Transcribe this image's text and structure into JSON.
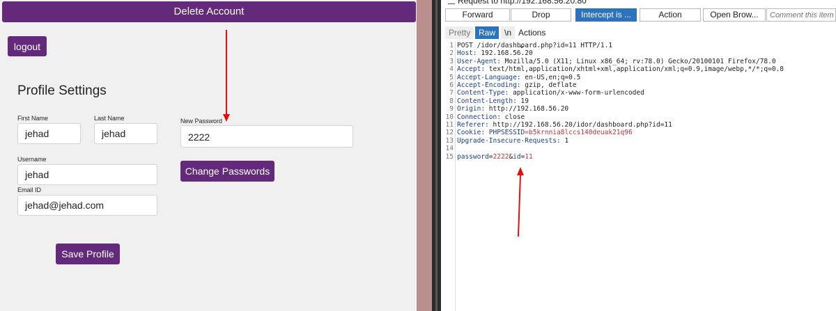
{
  "app": {
    "delete_account": "Delete Account",
    "logout": "logout",
    "profile_title": "Profile Settings",
    "first_name_label": "First Name",
    "first_name_value": "jehad",
    "last_name_label": "Last Name",
    "last_name_value": "jehad",
    "new_password_label": "New Password",
    "new_password_value": "2222",
    "change_password_button": "Change Passwords",
    "username_label": "Username",
    "username_value": "jehad",
    "email_label": "Email ID",
    "email_value": "jehad@jehad.com",
    "save_profile_button": "Save Profile",
    "accent_color": "#632a7c"
  },
  "burp": {
    "title": "Request to http://192.168.56.20:80",
    "toolbar": {
      "forward": "Forward",
      "drop": "Drop",
      "intercept": "Intercept is ...",
      "action": "Action",
      "open_browser": "Open Brow...",
      "comment_placeholder": "Comment this item"
    },
    "view_tabs": {
      "pretty": "Pretty",
      "raw": "Raw",
      "newline": "\\n",
      "actions": "Actions"
    },
    "line_numbers": [
      "1",
      "2",
      "3",
      "4",
      "5",
      "6",
      "7",
      "8",
      "9",
      "10",
      "11",
      "12",
      "13",
      "14",
      "15"
    ],
    "request": {
      "method_line": "POST /idor/dashboard.php?id=11 HTTP/1.1",
      "host_k": "Host:",
      "host_v": " 192.168.56.20",
      "ua_k": "User-Agent:",
      "ua_v": " Mozilla/5.0 (X11; Linux x86_64; rv:78.0) Gecko/20100101 Firefox/78.0",
      "accept_k": "Accept:",
      "accept_v": " text/html,application/xhtml+xml,application/xml;q=0.9,image/webp,*/*;q=0.8",
      "lang_k": "Accept-Language:",
      "lang_v": " en-US,en;q=0.5",
      "enc_k": "Accept-Encoding:",
      "enc_v": " gzip, deflate",
      "ctype_k": "Content-Type:",
      "ctype_v": " application/x-www-form-urlencoded",
      "clen_k": "Content-Length:",
      "clen_v": " 19",
      "origin_k": "Origin:",
      "origin_v": " http://192.168.56.20",
      "conn_k": "Connection:",
      "conn_v": " close",
      "ref_k": "Referer:",
      "ref_v": " http://192.168.56.20/idor/dashboard.php?id=11",
      "cookie_k": "Cookie:",
      "cookie_name": " PHPSESSID",
      "cookie_val": "=b5krnnia8lccs140deuak21q96",
      "uir_k": "Upgrade-Insecure-Requests:",
      "uir_v": " 1",
      "body_k1": "password",
      "body_v1": "2222",
      "body_k2": "id",
      "body_v2": "11"
    }
  }
}
